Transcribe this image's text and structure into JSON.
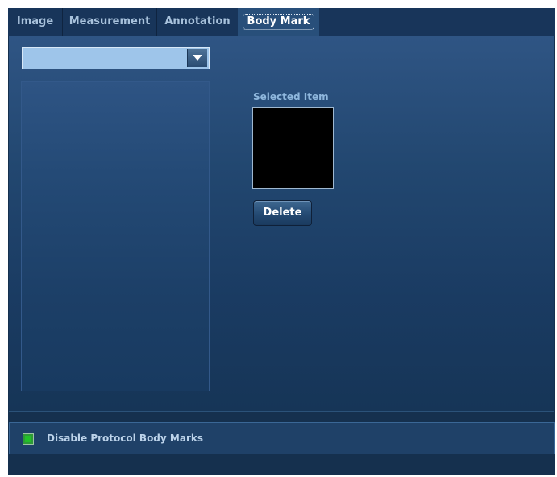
{
  "tabs": [
    {
      "label": "Image"
    },
    {
      "label": "Measurement"
    },
    {
      "label": "Annotation"
    },
    {
      "label": "Body Mark",
      "active": true
    }
  ],
  "body_mark": {
    "combo": {
      "value": ""
    },
    "selected_item_label": "Selected Item",
    "delete_label": "Delete"
  },
  "protocol": {
    "checkbox_label": "Disable Protocol Body Marks",
    "checked": true
  },
  "colors": {
    "panel_bg": "#15304e",
    "active_tab": "#284f7a",
    "combo_fill": "#9ec5ea",
    "check_green": "#22c128",
    "label_blue": "#8fb7dd"
  },
  "icons": {
    "combo_arrow": "triangle-down-icon",
    "checkbox": "green-square-check-icon"
  }
}
